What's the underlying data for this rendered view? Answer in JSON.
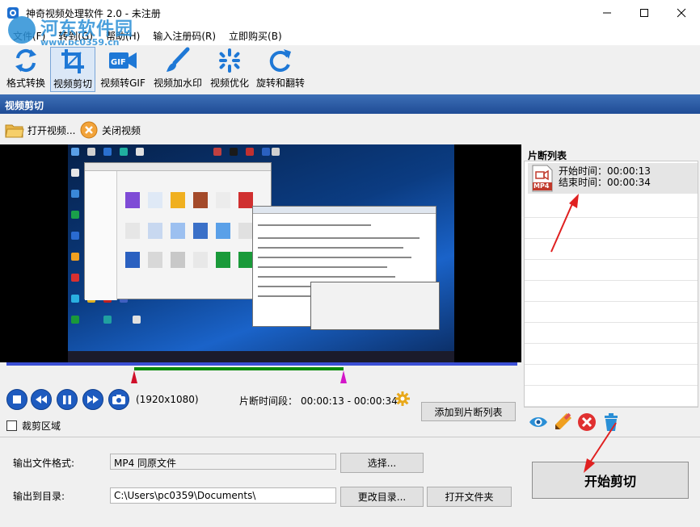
{
  "window": {
    "title": "神奇视频处理软件 2.0 - 未注册"
  },
  "watermark": {
    "text": "河东软件园",
    "url": "www.pc0359.cn"
  },
  "menu": [
    {
      "label": "文件(F)"
    },
    {
      "label": "转到(G)"
    },
    {
      "label": "帮助(H)"
    },
    {
      "label": "输入注册码(R)"
    },
    {
      "label": "立即购买(B)"
    }
  ],
  "toolbar": [
    {
      "label": "格式转换",
      "icon": "format-convert-icon"
    },
    {
      "label": "视频剪切",
      "icon": "crop-icon",
      "active": true
    },
    {
      "label": "视频转GIF",
      "icon": "gif-icon"
    },
    {
      "label": "视频加水印",
      "icon": "brush-icon"
    },
    {
      "label": "视频优化",
      "icon": "sparkle-icon"
    },
    {
      "label": "旋转和翻转",
      "icon": "rotate-icon"
    }
  ],
  "section": {
    "title": "视频剪切"
  },
  "subbar": {
    "open_label": "打开视频...",
    "close_label": "关闭视频"
  },
  "player": {
    "resolution": "(1920x1080)",
    "segment_label": "片断时间段：",
    "segment_value": "00:00:13 - 00:00:34",
    "progress_start_fraction": 0.25,
    "progress_end_fraction": 0.66
  },
  "buttons": {
    "add_to_list": "添加到片断列表",
    "select": "选择...",
    "change_dir": "更改目录...",
    "open_folder": "打开文件夹",
    "start_cut": "开始剪切"
  },
  "crop": {
    "label": "裁剪区域",
    "checked": false
  },
  "clip_list": {
    "title": "片断列表",
    "items": [
      {
        "format": "MP4",
        "start_label": "开始时间：",
        "start": "00:00:13",
        "end_label": "结束时间：",
        "end": "00:00:34"
      }
    ]
  },
  "output": {
    "format_label": "输出文件格式:",
    "format_value": "MP4 同原文件",
    "dir_label": "输出到目录:",
    "dir_value": "C:\\Users\\pc0359\\Documents\\"
  },
  "colors": {
    "accent": "#1f4c96",
    "timeline_track": "#3b4fd4",
    "timeline_range": "#0a8a0a",
    "marker_start": "#d0102a",
    "marker_end": "#d316c9",
    "arrow": "#e02020"
  }
}
